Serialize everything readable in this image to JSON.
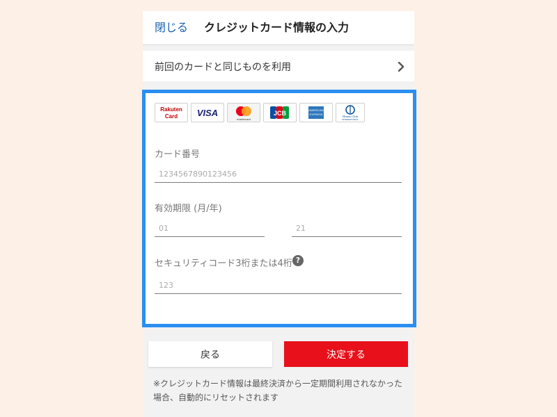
{
  "header": {
    "close_label": "閉じる",
    "title": "クレジットカード情報の入力"
  },
  "reuse_row": {
    "label": "前回のカードと同じものを利用"
  },
  "brands": [
    "Rakuten Card",
    "VISA",
    "mastercard",
    "JCB",
    "American Express",
    "Diners Club International"
  ],
  "brand_text": {
    "rakuten_line1": "Rakuten",
    "rakuten_line2": "Card",
    "visa": "VISA",
    "mastercard": "mastercard",
    "jcb": "JCB",
    "amex_line1": "AMERICAN",
    "amex_line2": "EXPRESS",
    "diners_line1": "Diners Club",
    "diners_line2": "INTERNATIONAL"
  },
  "form": {
    "card_number": {
      "label": "カード番号",
      "placeholder": "1234567890123456"
    },
    "expiry": {
      "label": "有効期限 (月/年)",
      "month_placeholder": "01",
      "year_placeholder": "21"
    },
    "cvc": {
      "label": "セキュリティコード3桁または4桁",
      "placeholder": "123",
      "help": "?"
    }
  },
  "buttons": {
    "back": "戻る",
    "submit": "決定する"
  },
  "note": "※クレジットカード情報は最終決済から一定期間利用されなかった場合、自動的にリセットされます",
  "colors": {
    "accent_blue": "#2a8ff0",
    "submit_red": "#e8101a",
    "link_blue": "#1a62b0",
    "background": "#fdf0e6"
  }
}
